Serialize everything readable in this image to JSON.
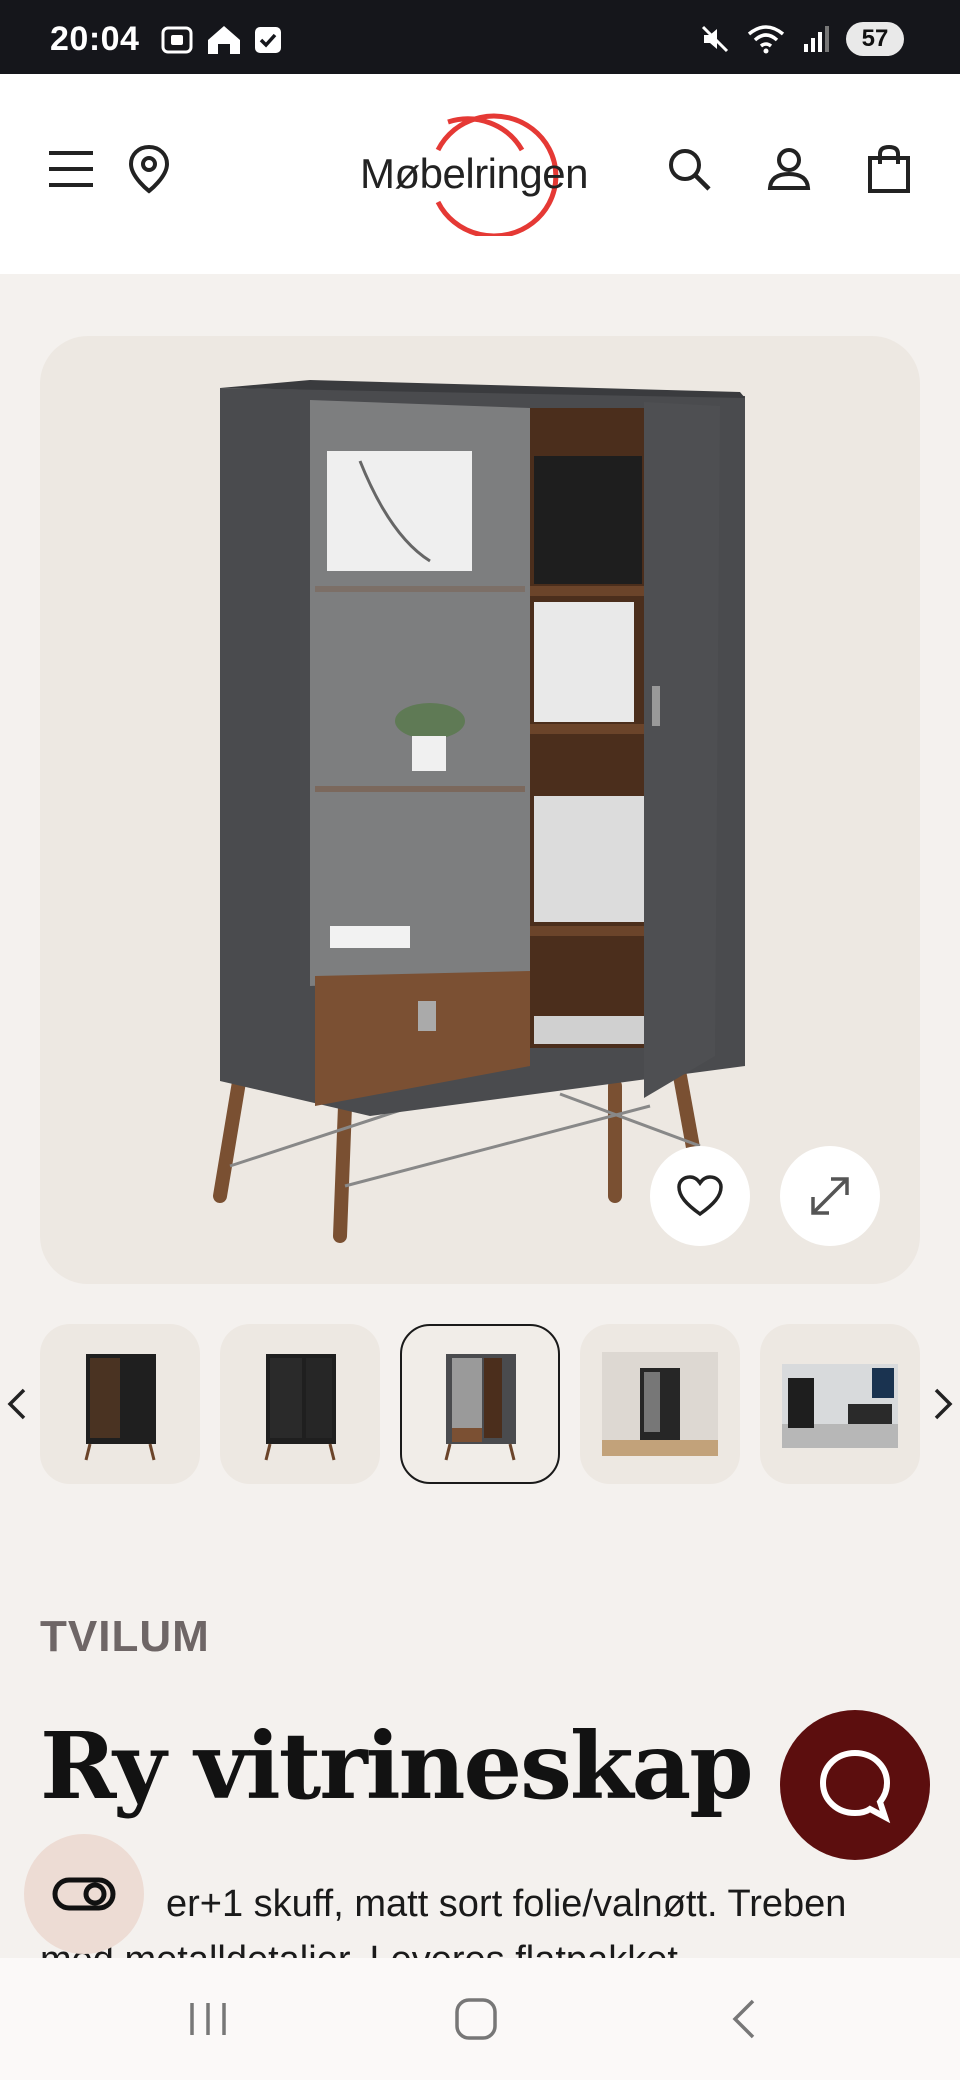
{
  "status_bar": {
    "time": "20:04",
    "battery": "57",
    "icons_left": [
      "screenshot-icon",
      "home-icon",
      "checkbox-icon"
    ],
    "icons_right": [
      "mute-icon",
      "wifi-icon",
      "signal-icon"
    ]
  },
  "header": {
    "logo_text": "Møbelringen",
    "logo_ring_color": "#e53935",
    "icons": [
      "menu-icon",
      "location-pin-icon",
      "search-icon",
      "user-icon",
      "bag-icon"
    ]
  },
  "product_image": {
    "favorite_icon": "heart-icon",
    "expand_icon": "expand-icon"
  },
  "thumbnails": {
    "count": 5,
    "active_index": 2
  },
  "product": {
    "brand": "TVILUM",
    "title": "Ry vitrineskap",
    "description_line1": "er+1 skuff, matt sort folie/valnøtt. Treben",
    "description_line2": "med metalldetaljer. Leveres flatpakket."
  },
  "fab": {
    "chat_color": "#5c0e0e",
    "accessibility_icon": "accessibility-toggle-icon"
  },
  "nav": {
    "items": [
      "recents-icon",
      "home-icon",
      "back-icon"
    ]
  }
}
